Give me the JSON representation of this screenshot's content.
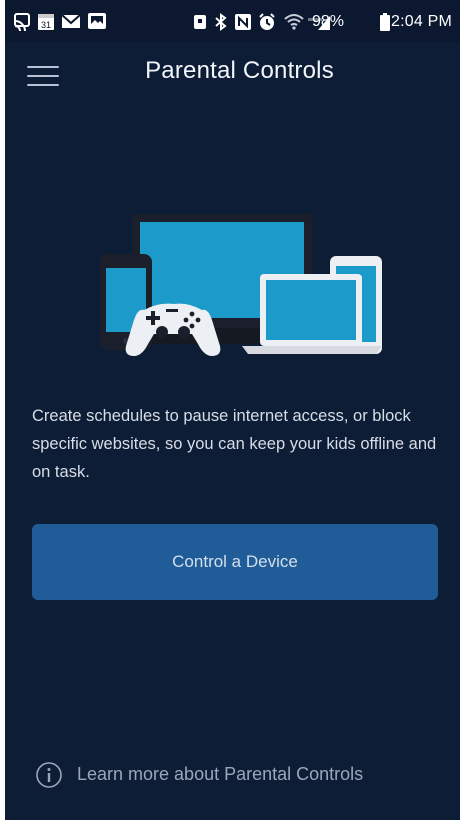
{
  "status_bar": {
    "battery_percent": "98%",
    "time": "12:04 PM",
    "notification_date": "31",
    "left_icons": [
      "cast-icon",
      "calendar-icon",
      "mail-icon",
      "gallery-icon"
    ],
    "right_icons": [
      "alarm-icon",
      "bluetooth-icon",
      "nfc-icon",
      "clock-icon",
      "wifi-icon",
      "signal-icon",
      "battery-icon"
    ]
  },
  "header": {
    "title": "Parental Controls",
    "menu_icon": "hamburger-menu-icon"
  },
  "illustration": {
    "devices": [
      "monitor-icon",
      "phone-icon",
      "game-controller-icon",
      "laptop-icon",
      "tablet-icon"
    ],
    "screen_color": "#1c9bcb",
    "frame_color": "#1a1f2b"
  },
  "main": {
    "description": "Create schedules to pause internet access, or block specific websites, so you can keep your kids offline and on task.",
    "primary_button_label": "Control a Device"
  },
  "footer": {
    "learn_more_label": "Learn more about Parental Controls",
    "info_icon": "info-icon"
  },
  "colors": {
    "background": "#0e1d36",
    "button": "#1f5c98",
    "muted_text": "#9ba6b8"
  }
}
